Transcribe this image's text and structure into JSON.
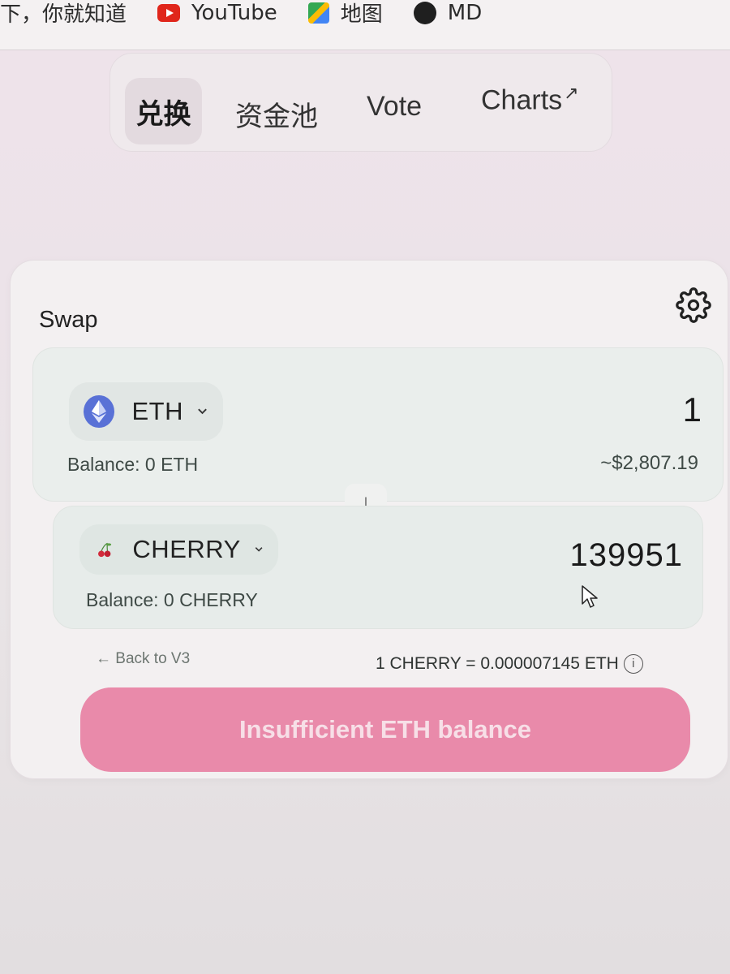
{
  "bookmarks": {
    "item1_label": "下，你就知道",
    "item2_label": "YouTube",
    "item3_label": "地图",
    "item4_label": "MD"
  },
  "nav": {
    "swap_label": "兑换",
    "pool_label": "资金池",
    "vote_label": "Vote",
    "charts_label": "Charts",
    "charts_arrow": "↗"
  },
  "swap": {
    "title": "Swap",
    "from": {
      "symbol": "ETH",
      "amount": "1",
      "balance": "Balance: 0 ETH",
      "usd_value": "~$2,807.19"
    },
    "flip_arrow": "↓",
    "to": {
      "symbol": "CHERRY",
      "amount": "139951",
      "balance": "Balance: 0 CHERRY"
    },
    "back_link": "← Back to V3",
    "rate": "1 CHERRY = 0.000007145 ETH",
    "info_glyph": "i",
    "submit_label": "Insufficient ETH balance"
  },
  "colors": {
    "submit_bg": "#e98aaa",
    "eth_icon": "#5971d6",
    "cherry": "#d22b3b"
  },
  "icons": {
    "settings": "gear-icon",
    "eth": "ethereum-icon",
    "cherry": "cherry-icon",
    "dropdown": "chevron-down-icon",
    "info": "info-icon"
  }
}
